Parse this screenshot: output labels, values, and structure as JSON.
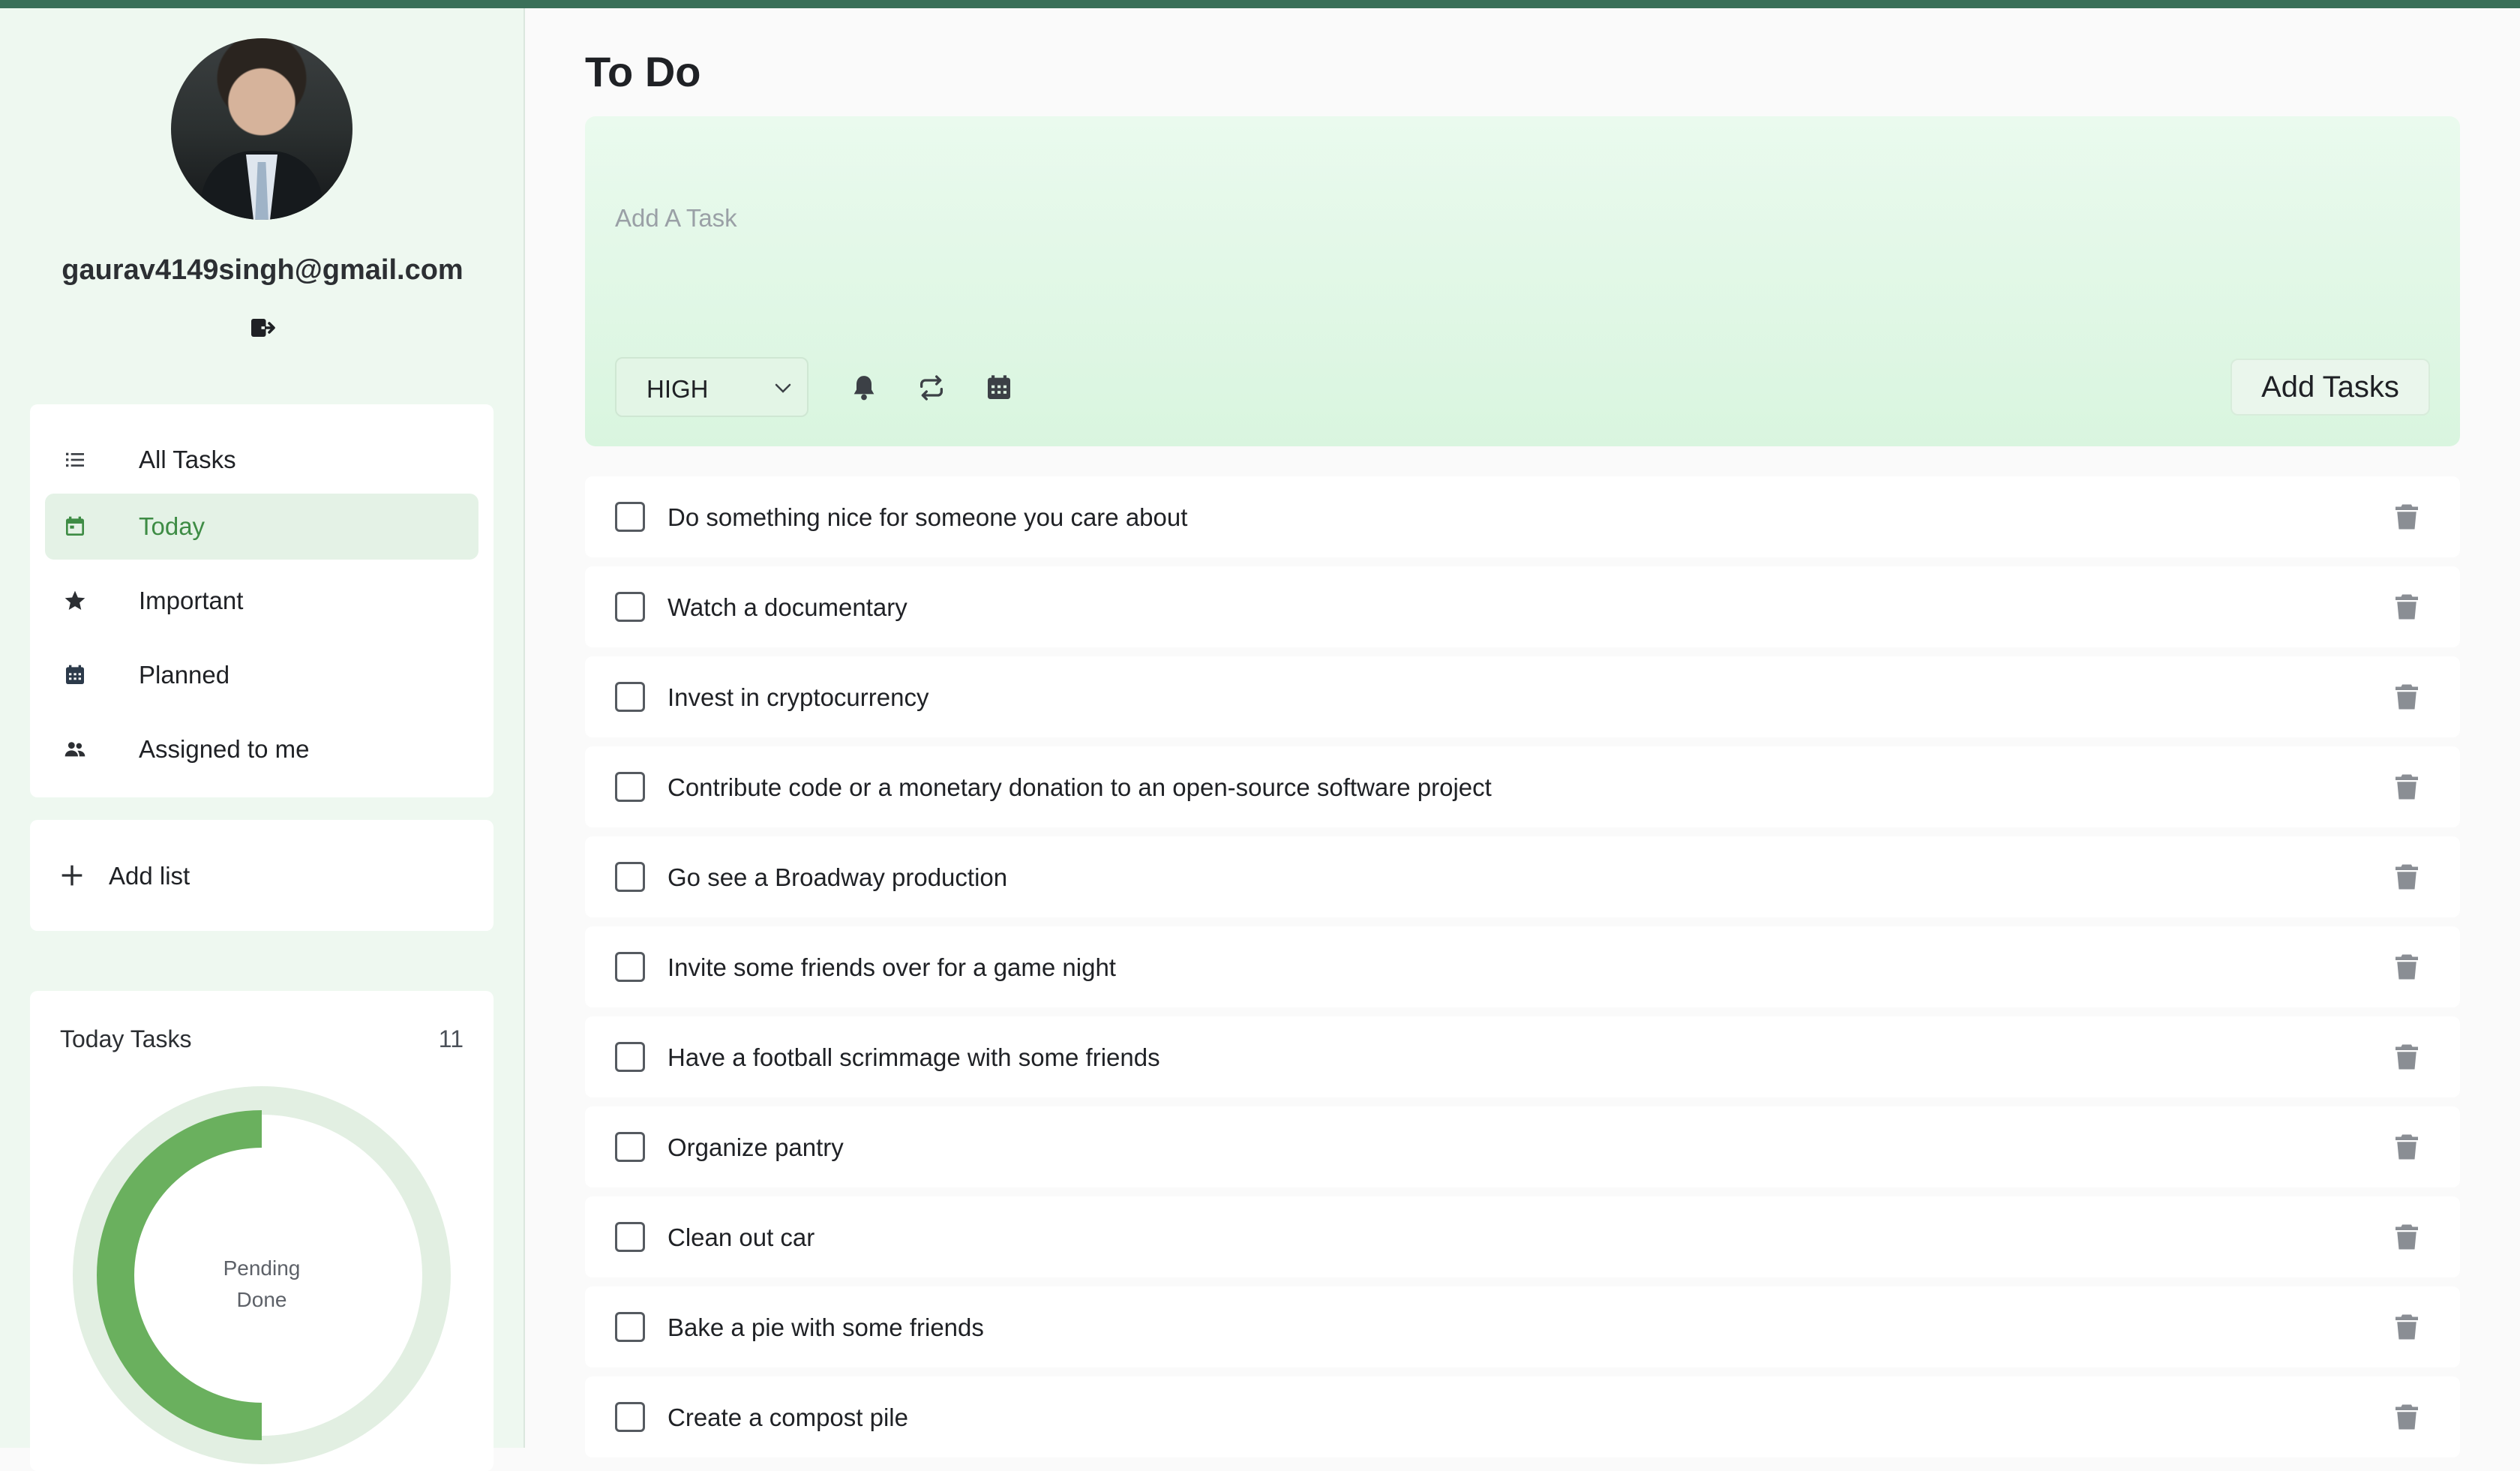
{
  "user": {
    "email": "gaurav4149singh@gmail.com"
  },
  "nav": {
    "items": [
      {
        "label": "All Tasks",
        "icon": "list-icon"
      },
      {
        "label": "Today",
        "icon": "calendar-today-icon",
        "active": true
      },
      {
        "label": "Important",
        "icon": "star-icon"
      },
      {
        "label": "Planned",
        "icon": "calendar-icon"
      },
      {
        "label": "Assigned to me",
        "icon": "people-icon"
      }
    ]
  },
  "add_list": {
    "label": "Add list"
  },
  "today_stats": {
    "title": "Today Tasks",
    "count": "11",
    "legend": {
      "pending": "Pending",
      "done": "Done"
    },
    "done_fraction": 0.5,
    "colors": {
      "done": "#6ab05e",
      "pending": "#e2efe2"
    }
  },
  "main": {
    "title": "To Do",
    "composer": {
      "placeholder": "Add A Task",
      "priority": "HIGH",
      "add_button": "Add Tasks"
    },
    "tasks": [
      "Do something nice for someone you care about",
      "Watch a documentary",
      "Invest in cryptocurrency",
      "Contribute code or a monetary donation to an open-source software project",
      "Go see a Broadway production",
      "Invite some friends over for a game night",
      "Have a football scrimmage with some friends",
      "Organize pantry",
      "Clean out car",
      "Bake a pie with some friends",
      "Create a compost pile"
    ]
  },
  "colors": {
    "accent": "#3e8c45",
    "topbar": "#3a7059",
    "sidebar": "#eef8f0"
  }
}
